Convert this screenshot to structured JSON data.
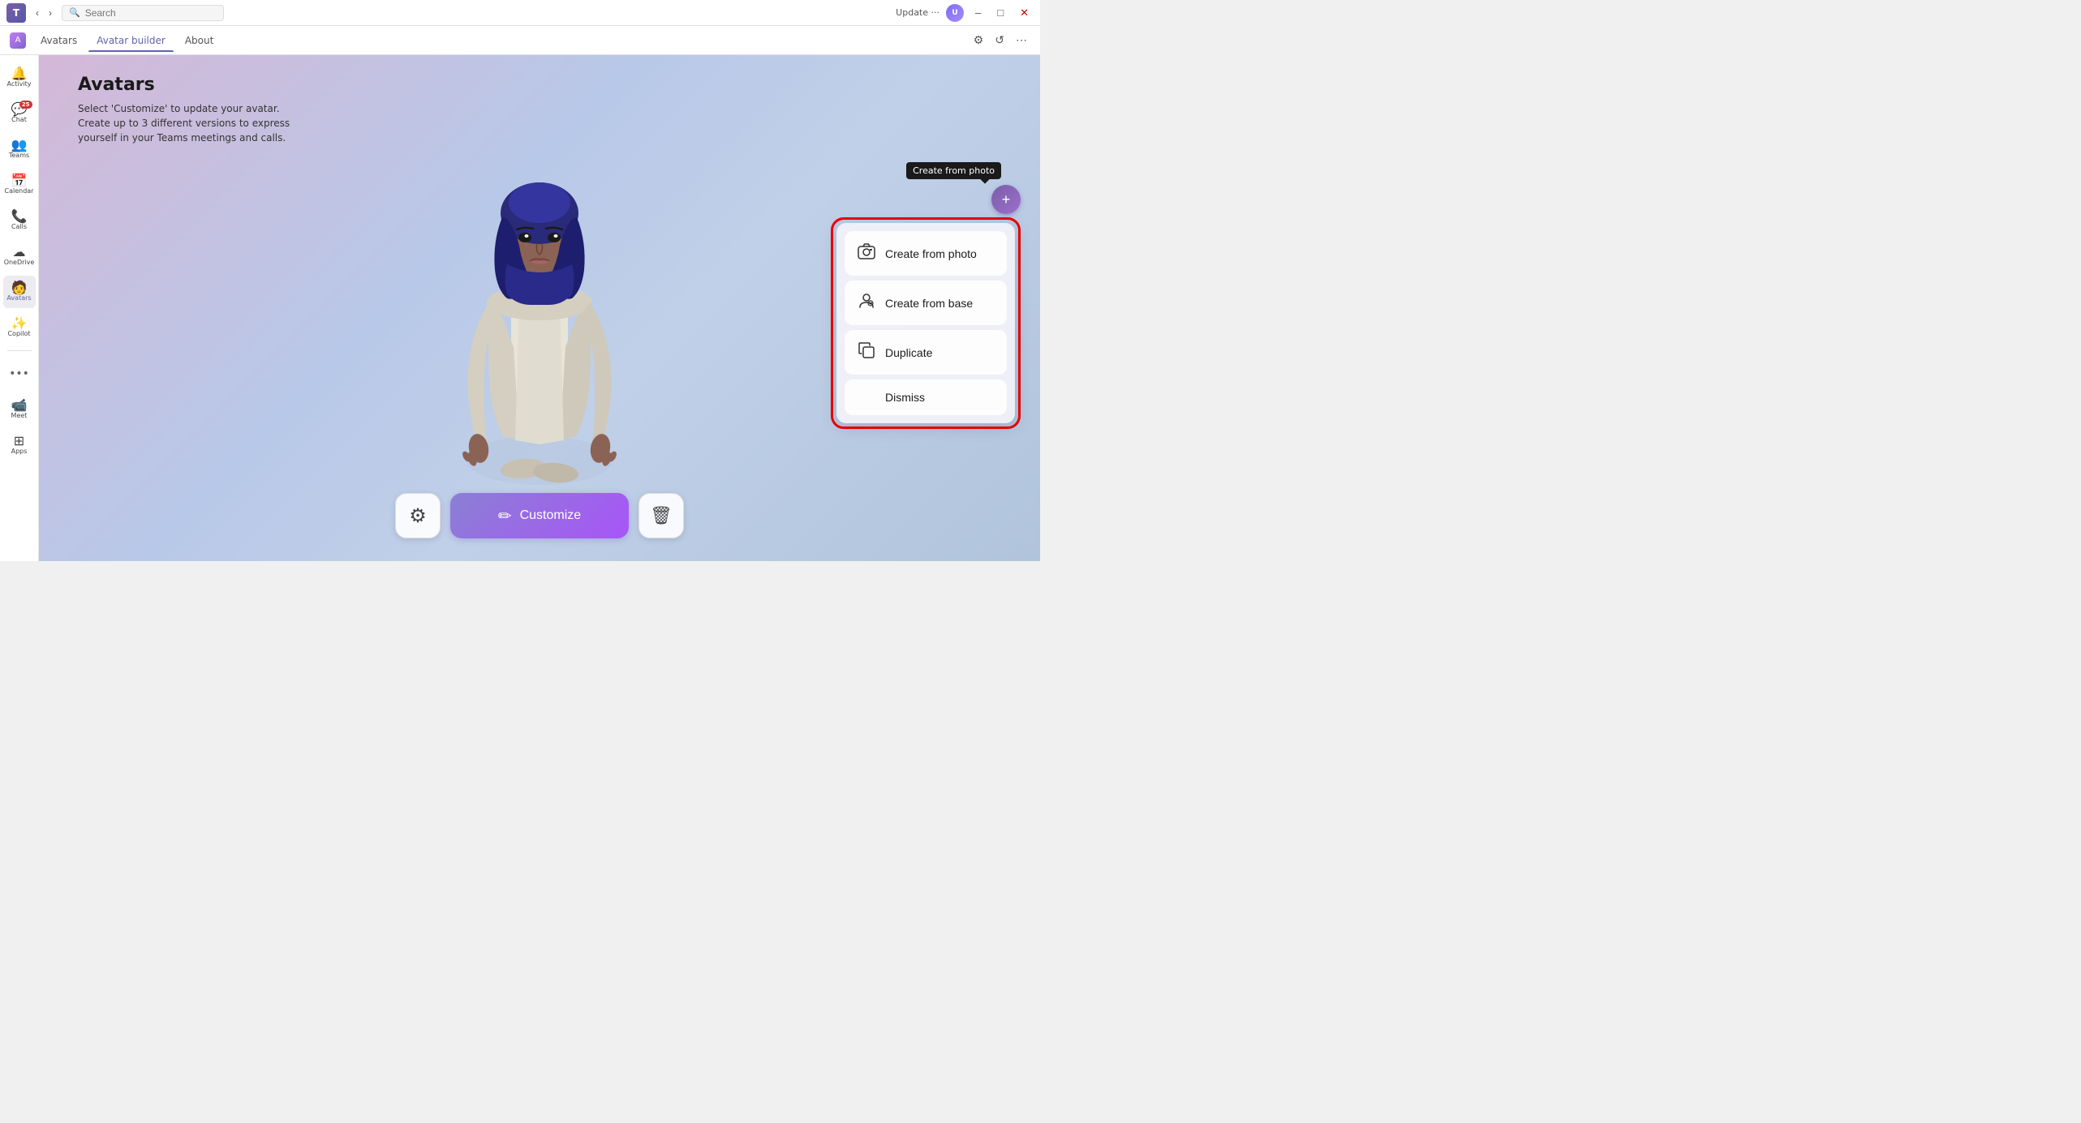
{
  "titlebar": {
    "update_label": "Update ···",
    "search_placeholder": "Search"
  },
  "tabs": {
    "app_name": "Avatars",
    "items": [
      {
        "id": "avatars",
        "label": "Avatars"
      },
      {
        "id": "avatar-builder",
        "label": "Avatar builder"
      },
      {
        "id": "about",
        "label": "About"
      }
    ],
    "active": "avatar-builder"
  },
  "sidebar": {
    "items": [
      {
        "id": "activity",
        "label": "Activity",
        "icon": "🔔",
        "badge": ""
      },
      {
        "id": "chat",
        "label": "Chat",
        "icon": "💬",
        "badge": "25"
      },
      {
        "id": "teams",
        "label": "Teams",
        "icon": "👥",
        "badge": ""
      },
      {
        "id": "calendar",
        "label": "Calendar",
        "icon": "📅",
        "badge": ""
      },
      {
        "id": "calls",
        "label": "Calls",
        "icon": "📞",
        "badge": ""
      },
      {
        "id": "onedrive",
        "label": "OneDrive",
        "icon": "☁",
        "badge": ""
      },
      {
        "id": "avatars",
        "label": "Avatars",
        "icon": "🧑",
        "badge": ""
      },
      {
        "id": "copilot",
        "label": "Copilot",
        "icon": "✨",
        "badge": ""
      },
      {
        "id": "meet",
        "label": "Meet",
        "icon": "📹",
        "badge": ""
      },
      {
        "id": "apps",
        "label": "Apps",
        "icon": "⊞",
        "badge": ""
      }
    ]
  },
  "page": {
    "title": "Avatars",
    "description_line1": "Select 'Customize' to update your avatar.",
    "description_line2": "Create up to 3 different versions to express",
    "description_line3": "yourself in your Teams meetings and calls."
  },
  "buttons": {
    "settings_icon": "⚙",
    "customize_label": "Customize",
    "customize_icon": "✏",
    "delete_icon": "🗑"
  },
  "popup": {
    "tooltip": "Create from photo",
    "menu_items": [
      {
        "id": "create-from-photo",
        "label": "Create from photo",
        "icon": "📷"
      },
      {
        "id": "create-from-base",
        "label": "Create from base",
        "icon": "👤"
      },
      {
        "id": "duplicate",
        "label": "Duplicate",
        "icon": "📋"
      },
      {
        "id": "dismiss",
        "label": "Dismiss",
        "icon": ""
      }
    ]
  }
}
